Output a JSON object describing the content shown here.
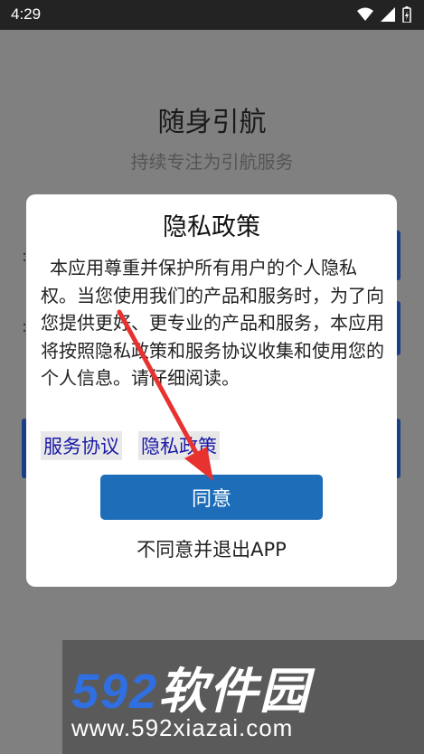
{
  "status_bar": {
    "time": "4:29"
  },
  "app": {
    "title": "随身引航",
    "subtitle": "持续专注为引航服务"
  },
  "dialog": {
    "title": "隐私政策",
    "body": "本应用尊重并保护所有用户的个人隐私权。当您使用我们的产品和服务时，为了向您提供更好、更专业的产品和服务，本应用将按照隐私政策和服务协议收集和使用您的个人信息。请仔细阅读。",
    "link_service": "服务协议",
    "link_privacy": "隐私政策",
    "agree_label": "同意",
    "disagree_label": "不同意并退出APP"
  },
  "watermark": {
    "brand_number": "592",
    "brand_name": "软件园",
    "url": "www.592xiazai.com"
  },
  "colors": {
    "accent": "#1e6db8",
    "link": "#1a1aa8",
    "annotation_arrow": "#e8322f"
  }
}
